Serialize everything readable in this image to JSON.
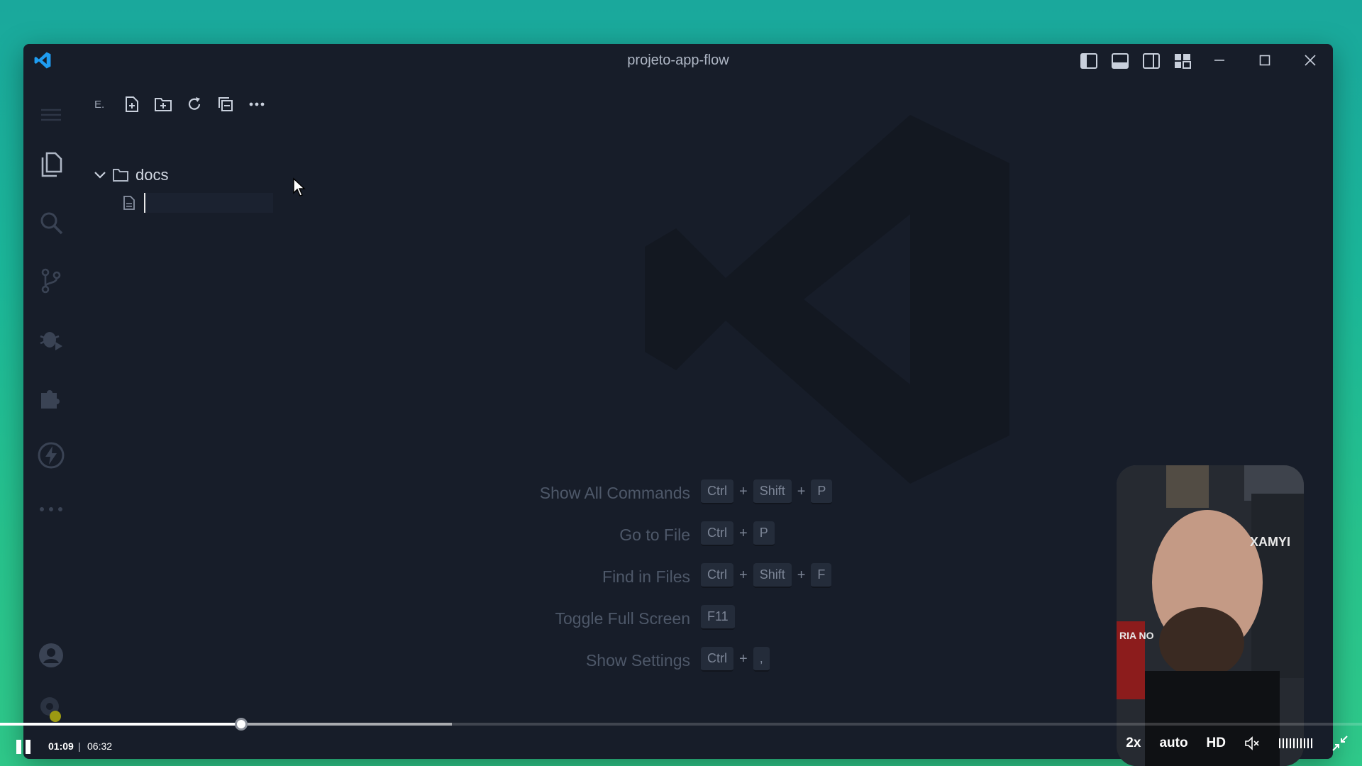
{
  "window": {
    "title": "projeto-app-flow"
  },
  "explorer": {
    "title": "E.",
    "folder": "docs",
    "new_file_value": ""
  },
  "shortcuts": [
    {
      "label": "Show All Commands",
      "keys": [
        "Ctrl",
        "+",
        "Shift",
        "+",
        "P"
      ]
    },
    {
      "label": "Go to File",
      "keys": [
        "Ctrl",
        "+",
        "P"
      ]
    },
    {
      "label": "Find in Files",
      "keys": [
        "Ctrl",
        "+",
        "Shift",
        "+",
        "F"
      ]
    },
    {
      "label": "Toggle Full Screen",
      "keys": [
        "F11"
      ]
    },
    {
      "label": "Show Settings",
      "keys": [
        "Ctrl",
        "+",
        ","
      ]
    }
  ],
  "webcam": {
    "overlay_text_1": "XAMYI",
    "overlay_text_2": "RIA NO"
  },
  "player": {
    "current_time": "01:09",
    "separator": "|",
    "total_time": "06:32",
    "progress": 0.177,
    "buffered": 0.332,
    "speed": "2x",
    "quality_mode": "auto",
    "quality": "HD"
  },
  "colors": {
    "accent": "#007acc",
    "editor_bg": "#171d29",
    "badge": "#c0a000"
  },
  "icons": [
    "vscode-logo-icon",
    "toggle-primary-sidebar-icon",
    "toggle-panel-icon",
    "toggle-secondary-sidebar-icon",
    "customize-layout-icon",
    "minimize-icon",
    "maximize-icon",
    "close-icon",
    "menu-icon",
    "explorer-icon",
    "search-icon",
    "source-control-icon",
    "run-debug-icon",
    "extensions-icon",
    "thunder-client-icon",
    "more-icon",
    "accounts-icon",
    "manage-gear-icon",
    "new-file-icon",
    "new-folder-icon",
    "refresh-icon",
    "collapse-all-icon",
    "ellipsis-icon",
    "chevron-down-icon",
    "folder-icon",
    "file-icon",
    "pause-icon",
    "volume-muted-icon",
    "exit-fullscreen-icon"
  ]
}
